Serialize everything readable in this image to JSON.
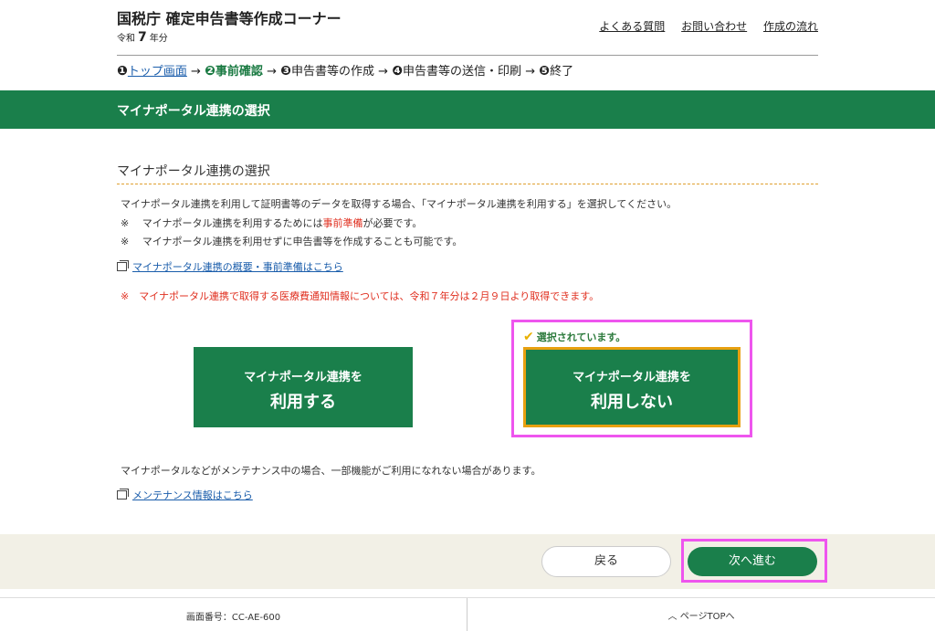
{
  "header": {
    "title": "国税庁 確定申告書等作成コーナー",
    "era_prefix": "令和",
    "era_year": "7",
    "era_suffix": "年分",
    "links": [
      "よくある質問",
      "お問い合わせ",
      "作成の流れ"
    ]
  },
  "steps": [
    {
      "num": "❶",
      "label": "トップ画面",
      "state": "link"
    },
    {
      "num": "❷",
      "label": "事前確認",
      "state": "current"
    },
    {
      "num": "❸",
      "label": "申告書等の作成",
      "state": "plain"
    },
    {
      "num": "❹",
      "label": "申告書等の送信・印刷",
      "state": "plain"
    },
    {
      "num": "❺",
      "label": "終了",
      "state": "plain"
    }
  ],
  "steps_arrow": "→",
  "banner": {
    "title": "マイナポータル連携の選択"
  },
  "section": {
    "title": "マイナポータル連携の選択",
    "intro": "マイナポータル連携を利用して証明書等のデータを取得する場合、「マイナポータル連携を利用する」を選択してください。",
    "note_mark": "※",
    "note1_before": "マイナポータル連携を利用するためには",
    "note1_red": "事前準備",
    "note1_after": "が必要です。",
    "note2": "マイナポータル連携を利用せずに申告書等を作成することも可能です。",
    "overview_link": "マイナポータル連携の概要・事前準備はこちら",
    "warning": "※　マイナポータル連携で取得する医療費通知情報については、令和７年分は２月９日より取得できます。"
  },
  "choices": {
    "use_line1": "マイナポータル連携を",
    "use_line2": "利用する",
    "nouse_line1": "マイナポータル連携を",
    "nouse_line2": "利用しない",
    "selected_note": "選択されています。",
    "selected": "nouse"
  },
  "maintenance": {
    "text": "マイナポータルなどがメンテナンス中の場合、一部機能がご利用になれない場合があります。",
    "link": "メンテナンス情報はこちら"
  },
  "nav": {
    "back": "戻る",
    "next": "次へ進む"
  },
  "footer": {
    "screen_id": "画面番号：CC-AE-600",
    "page_top": "ページTOPへ"
  },
  "colors": {
    "primary_green": "#1a7f4b",
    "highlight_magenta": "#ee55ee",
    "selected_border": "#e8a010",
    "warning_red": "#e03020"
  }
}
